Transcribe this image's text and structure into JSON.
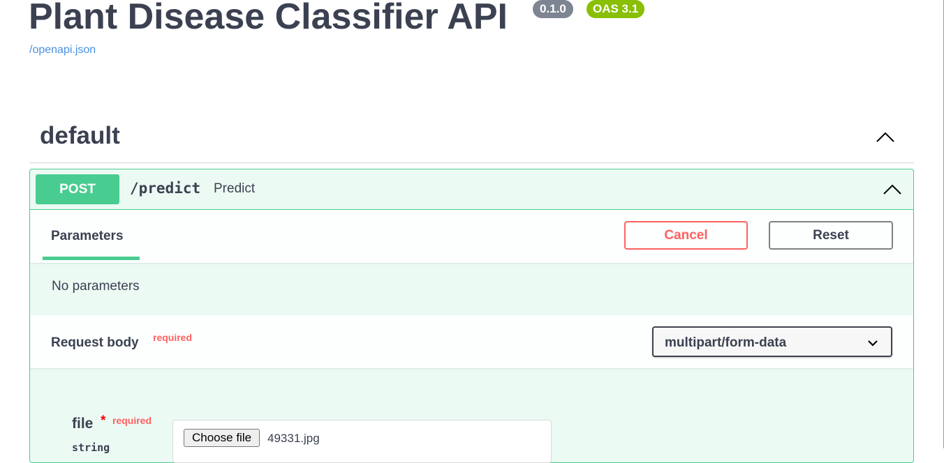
{
  "info": {
    "title": "Plant Disease Classifier API",
    "version": "0.1.0",
    "oas": "OAS 3.1",
    "spec_link": "/openapi.json"
  },
  "tag": {
    "name": "default",
    "chevron_icon": "chevron-up-icon"
  },
  "operation": {
    "method": "POST",
    "path": "/predict",
    "summary": "Predict",
    "method_color": "#49cc90",
    "chevron_icon": "chevron-up-icon"
  },
  "parameters": {
    "tab_label": "Parameters",
    "cancel_label": "Cancel",
    "reset_label": "Reset",
    "empty_text": "No parameters"
  },
  "request_body": {
    "label": "Request body",
    "required": "required",
    "content_type": "multipart/form-data",
    "dropdown_icon": "chevron-down-icon"
  },
  "file_param": {
    "name": "file",
    "star": "*",
    "required": "required",
    "type": "string",
    "button_label": "Choose file",
    "file_name": "49331.jpg"
  }
}
